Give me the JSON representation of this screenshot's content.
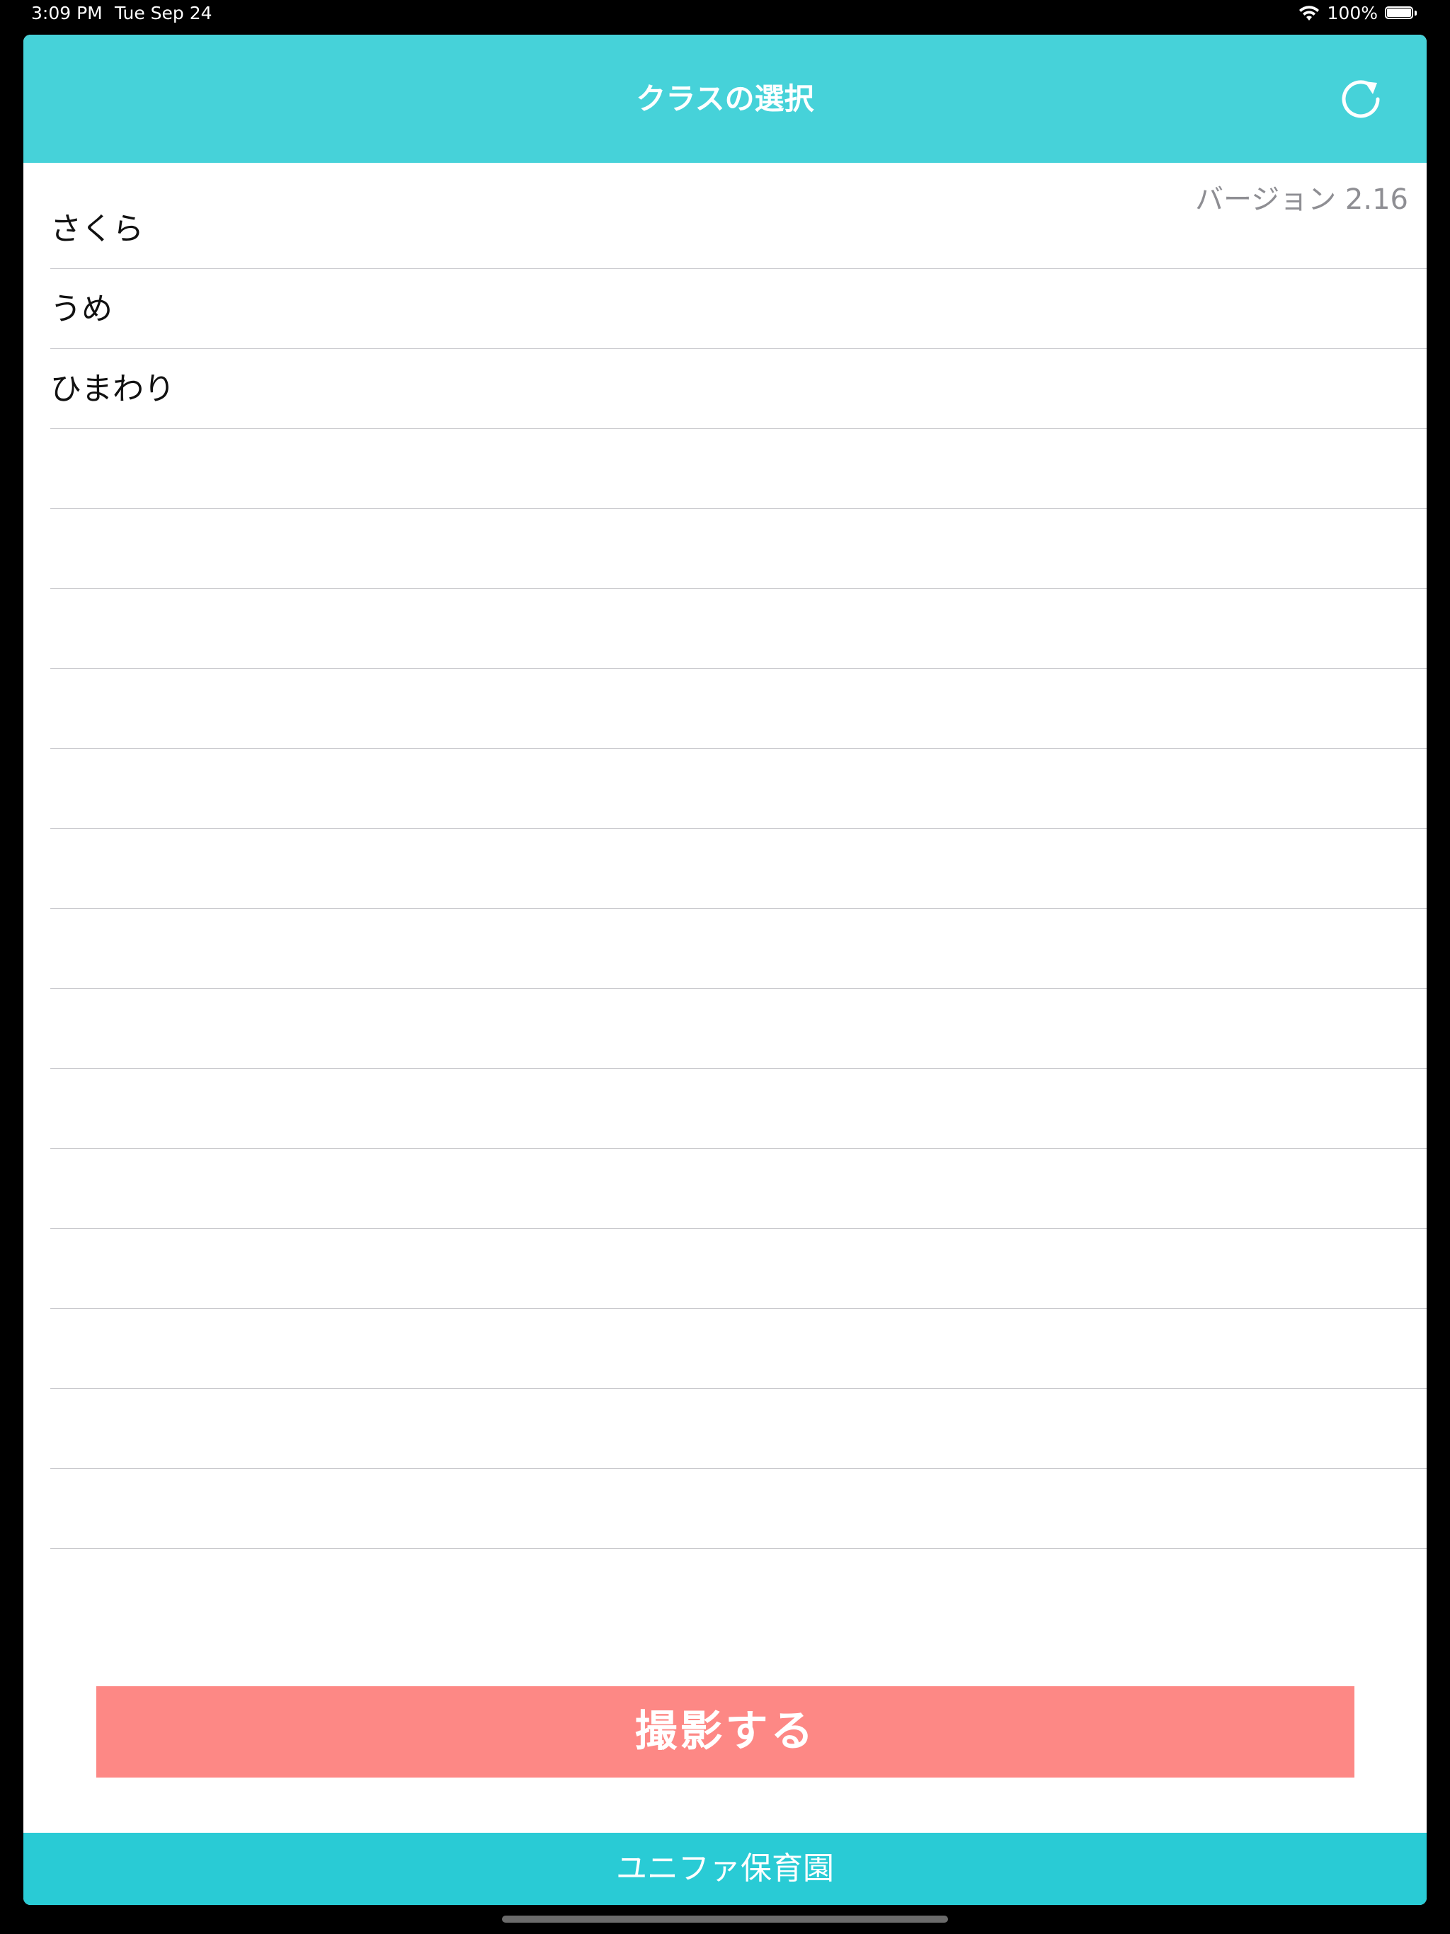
{
  "status_bar": {
    "time": "3:09 PM",
    "date": "Tue Sep 24",
    "battery_percent": "100%",
    "battery_level": 1.0,
    "icons": [
      "wifi-icon",
      "battery-icon"
    ]
  },
  "nav": {
    "title": "クラスの選択",
    "refresh_icon": "refresh-icon",
    "color": "#46d2d9"
  },
  "version": "バージョン 2.16",
  "classes": [
    {
      "label": "さくら"
    },
    {
      "label": "うめ"
    },
    {
      "label": "ひまわり"
    }
  ],
  "empty_rows": 14,
  "shoot_button": {
    "label": "撮影する",
    "color": "#fd8885"
  },
  "footer": {
    "label": "ユニファ保育園",
    "color": "#29cbd5"
  }
}
